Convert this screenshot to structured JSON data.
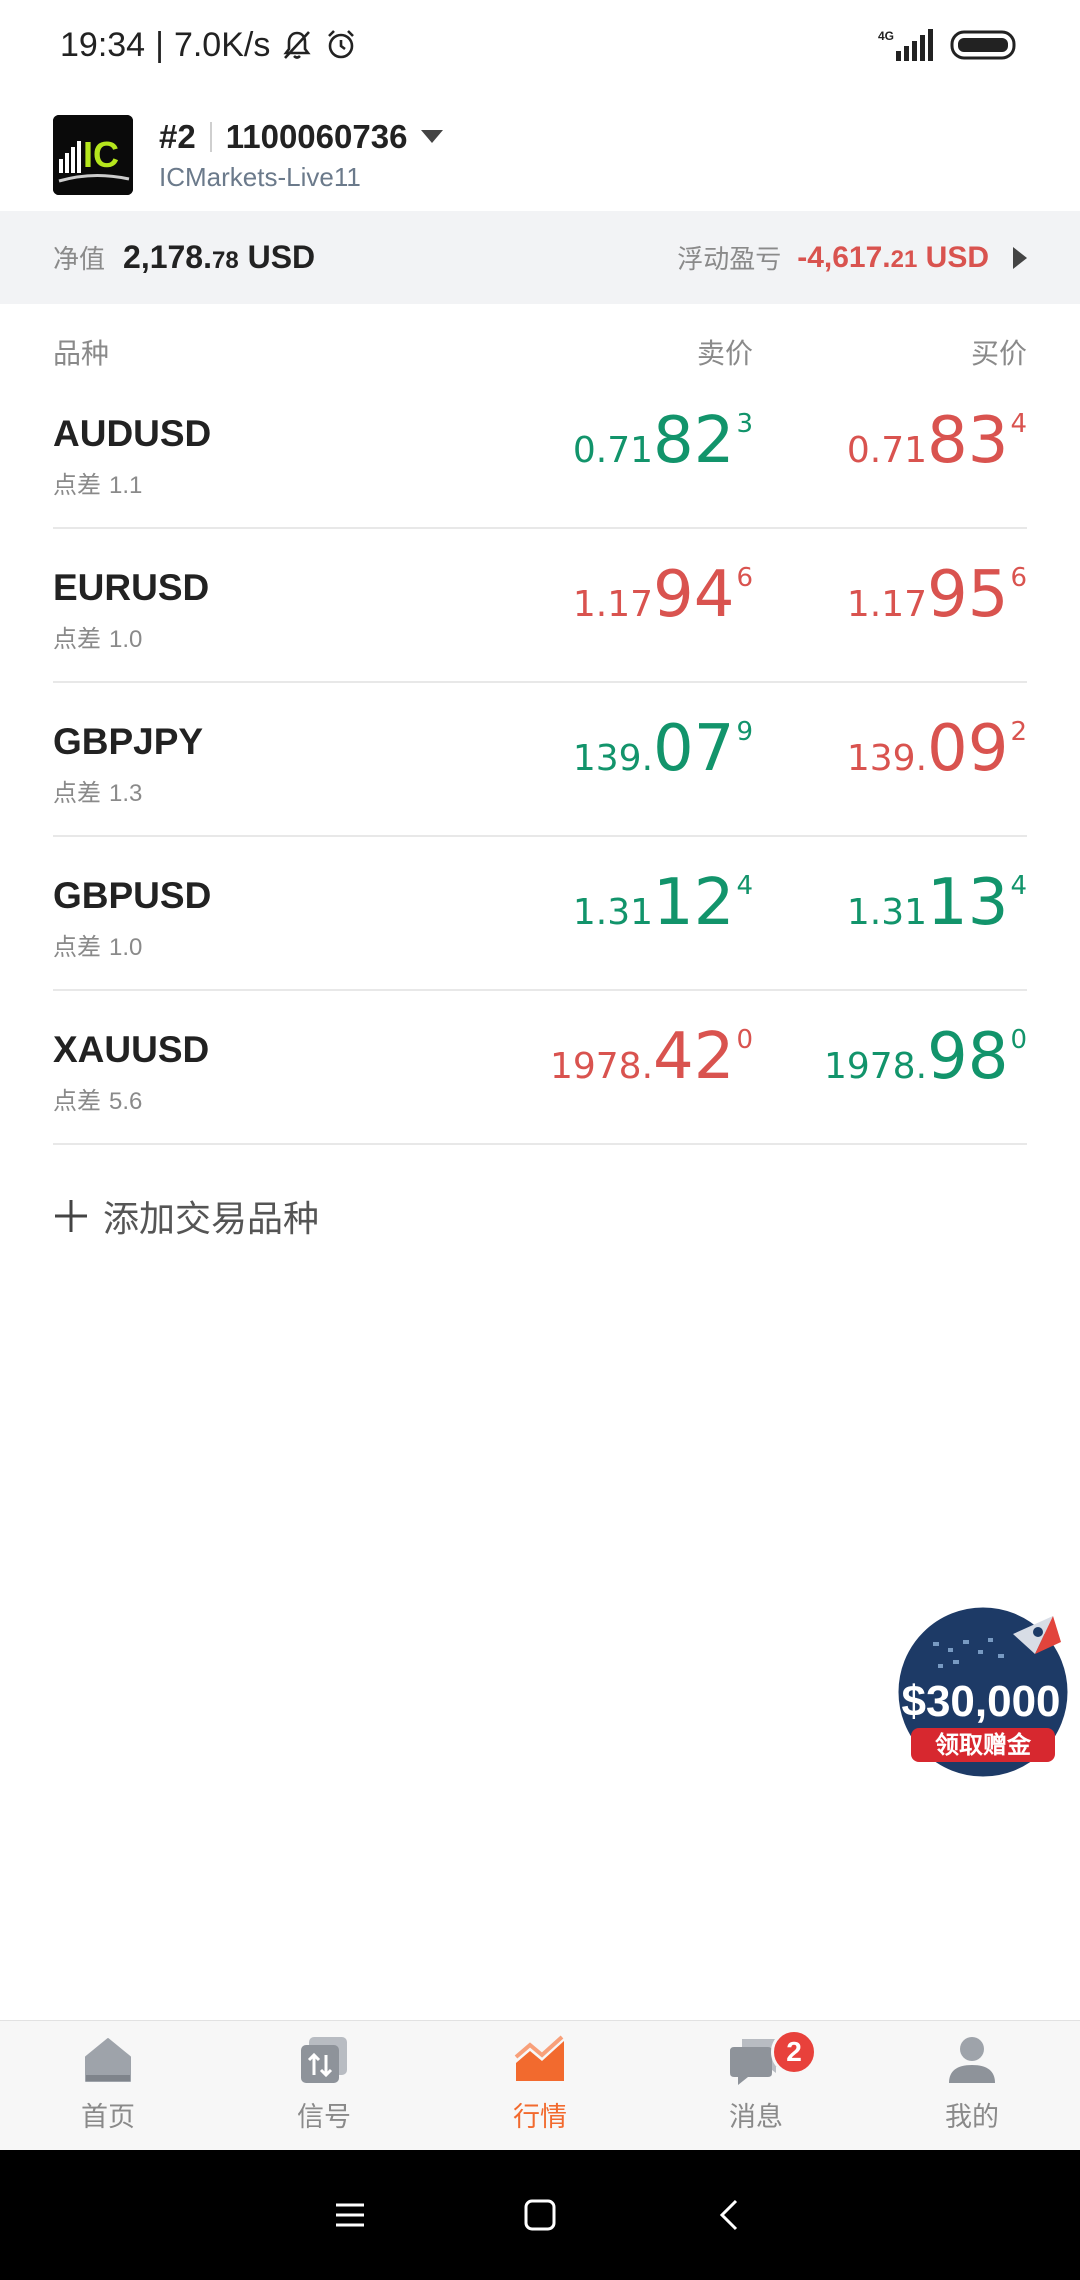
{
  "status_bar": {
    "time": "19:34",
    "speed": "7.0K/s",
    "network": "4G"
  },
  "account": {
    "logo_text": "IC",
    "index": "#2",
    "number": "1100060736",
    "server": "ICMarkets-Live11"
  },
  "summary": {
    "equity_label": "净值",
    "equity_main": "2,178.",
    "equity_dec": "78",
    "equity_unit": " USD",
    "pl_label": "浮动盈亏",
    "pl_main": "-4,617.",
    "pl_dec": "21",
    "pl_unit": " USD"
  },
  "columns": {
    "symbol": "品种",
    "bid": "卖价",
    "ask": "买价"
  },
  "spread_label": "点差",
  "quotes": [
    {
      "symbol": "AUDUSD",
      "spread": "1.1",
      "bid": {
        "base": "0.71",
        "big": "82",
        "sup": "3",
        "color": "green"
      },
      "ask": {
        "base": "0.71",
        "big": "83",
        "sup": "4",
        "color": "red"
      }
    },
    {
      "symbol": "EURUSD",
      "spread": "1.0",
      "bid": {
        "base": "1.17",
        "big": "94",
        "sup": "6",
        "color": "red"
      },
      "ask": {
        "base": "1.17",
        "big": "95",
        "sup": "6",
        "color": "red"
      }
    },
    {
      "symbol": "GBPJPY",
      "spread": "1.3",
      "bid": {
        "base": "139.",
        "big": "07",
        "sup": "9",
        "color": "green"
      },
      "ask": {
        "base": "139.",
        "big": "09",
        "sup": "2",
        "color": "red"
      }
    },
    {
      "symbol": "GBPUSD",
      "spread": "1.0",
      "bid": {
        "base": "1.31",
        "big": "12",
        "sup": "4",
        "color": "green"
      },
      "ask": {
        "base": "1.31",
        "big": "13",
        "sup": "4",
        "color": "green"
      }
    },
    {
      "symbol": "XAUUSD",
      "spread": "5.6",
      "bid": {
        "base": "1978.",
        "big": "42",
        "sup": "0",
        "color": "red"
      },
      "ask": {
        "base": "1978.",
        "big": "98",
        "sup": "0",
        "color": "green"
      }
    }
  ],
  "add_symbol": "添加交易品种",
  "promo": {
    "amount": "$30,000",
    "cta": "领取赠金"
  },
  "nav": {
    "items": [
      {
        "label": "首页",
        "icon": "home-icon"
      },
      {
        "label": "信号",
        "icon": "signal-icon"
      },
      {
        "label": "行情",
        "icon": "market-chart-icon"
      },
      {
        "label": "消息",
        "icon": "message-icon",
        "badge": "2"
      },
      {
        "label": "我的",
        "icon": "profile-icon"
      }
    ],
    "active_index": 2
  },
  "colors": {
    "up_green": "#12946b",
    "down_red": "#d9534f",
    "accent_orange": "#f26a2e"
  }
}
